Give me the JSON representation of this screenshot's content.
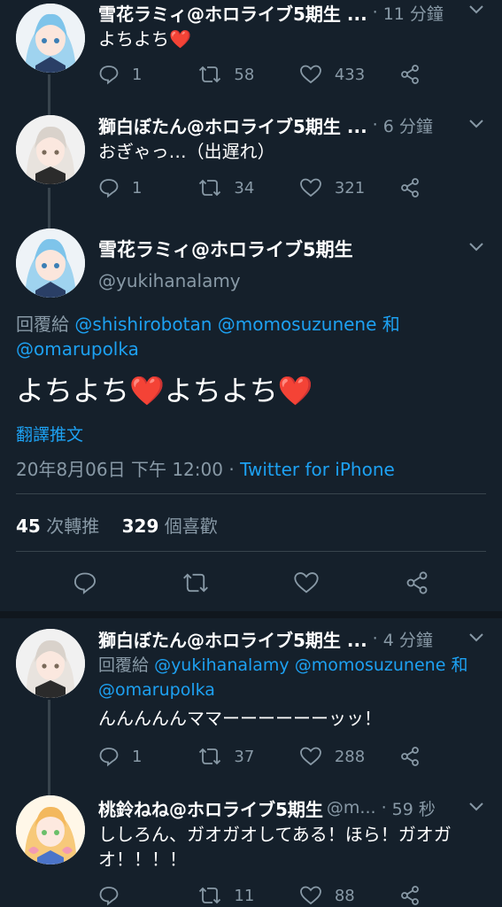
{
  "tweets_top": [
    {
      "name": "雪花ラミィ@ホロライブ5期生 ...",
      "time": "11 分鐘",
      "text": "よちよち❤️",
      "replies": "1",
      "retweets": "58",
      "likes": "433"
    },
    {
      "name": "獅白ぼたん@ホロライブ5期生 ...",
      "time": "6 分鐘",
      "text": "おぎゃっ…（出遅れ）",
      "replies": "1",
      "retweets": "34",
      "likes": "321"
    }
  ],
  "main_tweet": {
    "name": "雪花ラミィ@ホロライブ5期生",
    "handle": "@yukihanalamy",
    "reply_prefix": "回覆給",
    "reply_mentions": "@shishirobotan @momosuzunene",
    "reply_and": "和",
    "reply_mention_last": "@omarupolka",
    "text": "よちよち❤️よちよち❤️",
    "translate": "翻譯推文",
    "date": "20年8月06日 下午 12:00 ·",
    "source": "Twitter for iPhone",
    "retweet_count": "45",
    "retweet_label": "次轉推",
    "like_count": "329",
    "like_label": "個喜歡"
  },
  "tweets_bottom": [
    {
      "name": "獅白ぼたん@ホロライブ5期生 ...",
      "time": "4 分鐘",
      "reply_prefix": "回覆給",
      "reply_mentions": "@yukihanalamy @momosuzunene",
      "reply_and": "和",
      "reply_mention_last": "@omarupolka",
      "text": "んんんんんママーーーーーーッッ！",
      "replies": "1",
      "retweets": "37",
      "likes": "288"
    },
    {
      "name": "桃鈴ねね@ホロライブ5期生",
      "handle": "@m...",
      "time": "59 秒",
      "text": "ししろん、ガオガオしてある！ほら！ガオガオ！！！！",
      "replies": "",
      "retweets": "11",
      "likes": "88"
    }
  ],
  "colors": {
    "background": "#15202b",
    "secondary_text": "#8899a6",
    "link": "#1da1f2",
    "heart": "#e0245e"
  },
  "icons": [
    "reply-icon",
    "retweet-icon",
    "like-icon",
    "share-icon",
    "chevron-down-icon"
  ]
}
